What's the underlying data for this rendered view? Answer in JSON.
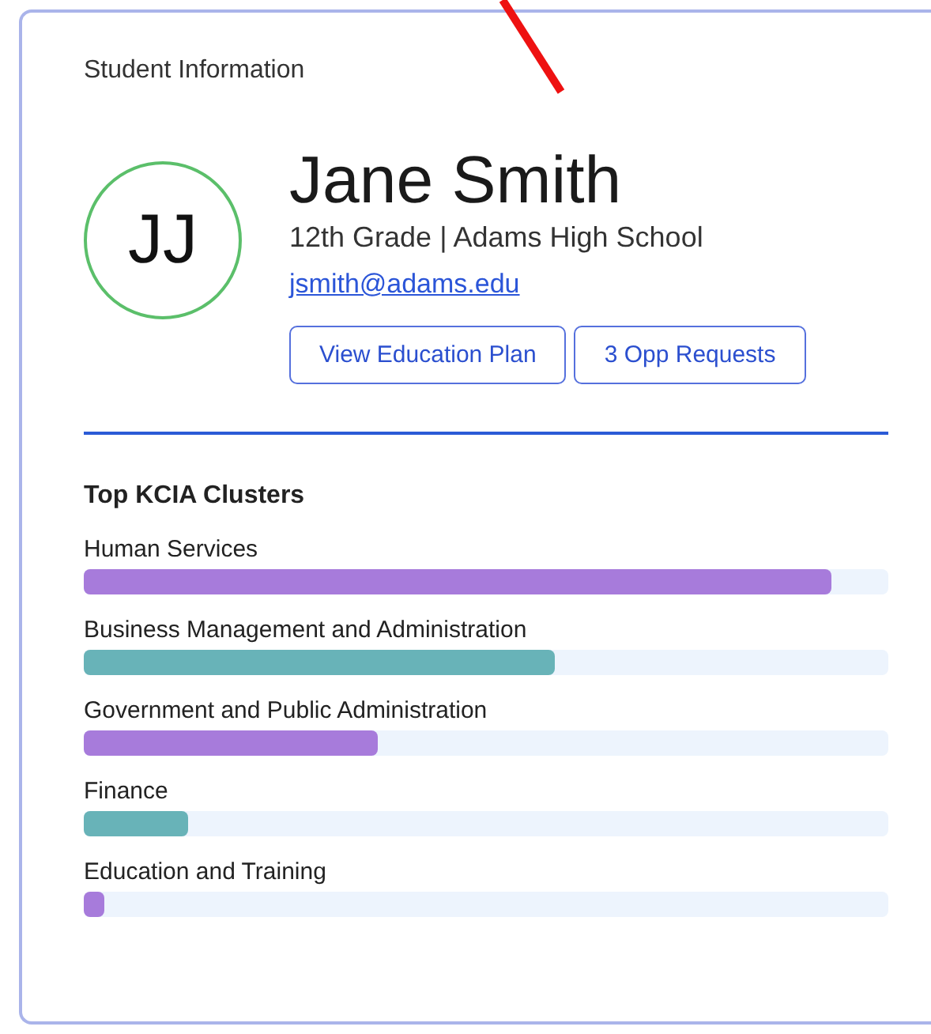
{
  "card": {
    "title": "Student Information"
  },
  "student": {
    "initials": "JJ",
    "name": "Jane Smith",
    "details": "12th Grade | Adams High School",
    "email": "jsmith@adams.edu"
  },
  "buttons": [
    "View Education Plan",
    "3 Opp Requests"
  ],
  "clusters": {
    "title": "Top KCIA Clusters",
    "items": [
      {
        "name": "Human Services",
        "level": 0.93,
        "color": "#a77bdb"
      },
      {
        "name": "Business Management and Administration",
        "level": 0.585,
        "color": "#68b3b8"
      },
      {
        "name": "Government and Public Administration",
        "level": 0.365,
        "color": "#a77bdb"
      },
      {
        "name": "Finance",
        "level": 0.13,
        "color": "#68b3b8"
      },
      {
        "name": "Education and Training",
        "level": 0.026,
        "color": "#a77bdb"
      }
    ]
  }
}
